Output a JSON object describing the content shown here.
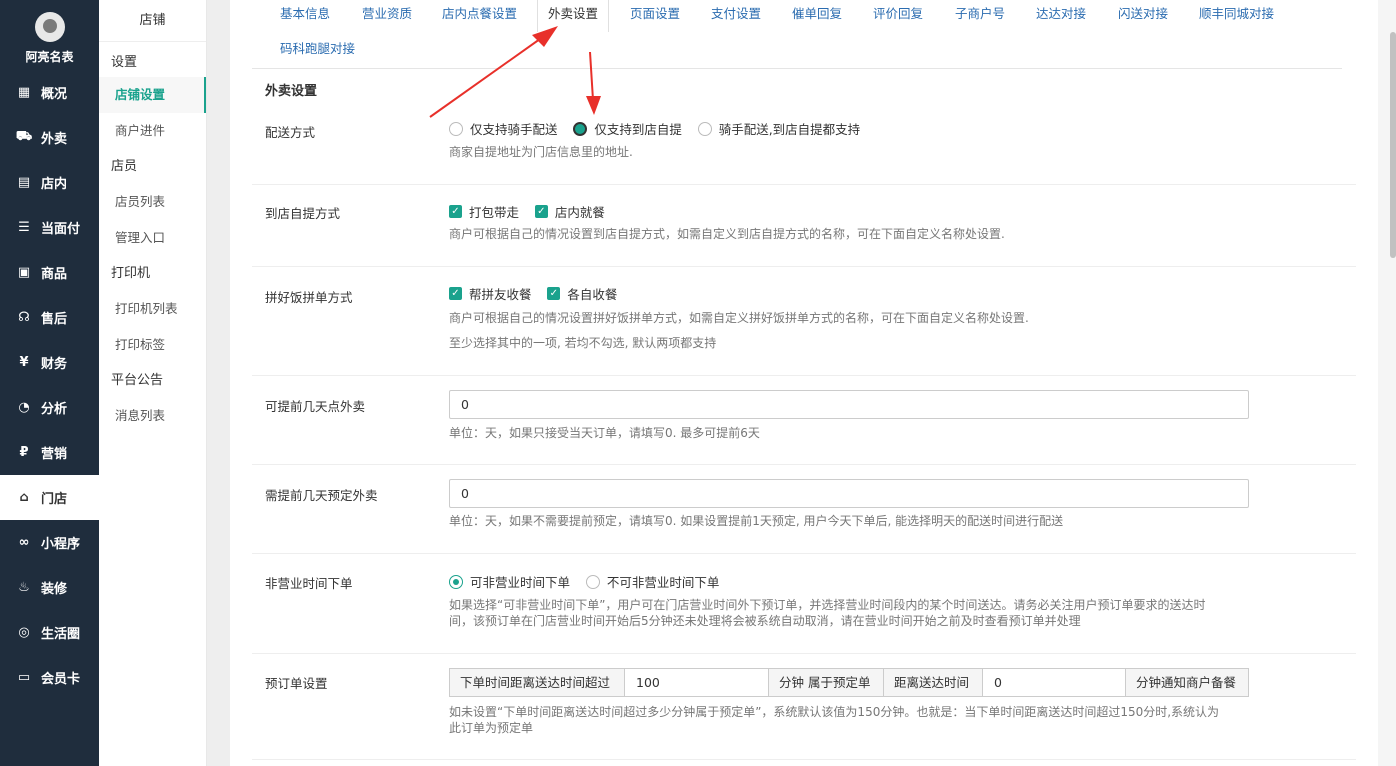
{
  "sidebar": {
    "brand": "阿亮名表",
    "items": [
      {
        "label": "概况",
        "icon": "overview-icon",
        "glyph": "▦"
      },
      {
        "label": "外卖",
        "icon": "delivery-icon",
        "glyph": "⛟"
      },
      {
        "label": "店内",
        "icon": "store-icon",
        "glyph": "▤"
      },
      {
        "label": "当面付",
        "icon": "pay-icon",
        "glyph": "☰"
      },
      {
        "label": "商品",
        "icon": "goods-icon",
        "glyph": "▣"
      },
      {
        "label": "售后",
        "icon": "aftersale-icon",
        "glyph": "☊"
      },
      {
        "label": "财务",
        "icon": "finance-icon",
        "glyph": "¥"
      },
      {
        "label": "分析",
        "icon": "analysis-icon",
        "glyph": "◔"
      },
      {
        "label": "营销",
        "icon": "marketing-icon",
        "glyph": "₽"
      },
      {
        "label": "门店",
        "icon": "shop-icon",
        "glyph": "⌂"
      },
      {
        "label": "小程序",
        "icon": "miniapp-icon",
        "glyph": "∞"
      },
      {
        "label": "装修",
        "icon": "decorate-icon",
        "glyph": "♨"
      },
      {
        "label": "生活圈",
        "icon": "life-icon",
        "glyph": "◎"
      },
      {
        "label": "会员卡",
        "icon": "card-icon",
        "glyph": "▭"
      }
    ]
  },
  "submenu": {
    "title": "店铺",
    "g1": "设置",
    "i1": "店铺设置",
    "i2": "商户进件",
    "g2": "店员",
    "i3": "店员列表",
    "i4": "管理入口",
    "g3": "打印机",
    "i5": "打印机列表",
    "i6": "打印标签",
    "g4": "平台公告",
    "i7": "消息列表"
  },
  "tabs": {
    "t1": "基本信息",
    "t2": "营业资质",
    "t3": "店内点餐设置",
    "t4": "外卖设置",
    "t5": "页面设置",
    "t6": "支付设置",
    "t7": "催单回复",
    "t8": "评价回复",
    "t9": "子商户号",
    "t10": "达达对接",
    "t11": "闪送对接",
    "t12": "顺丰同城对接",
    "t13": "码科跑腿对接"
  },
  "section_title": "外卖设置",
  "delivery": {
    "label": "配送方式",
    "opt1": "仅支持骑手配送",
    "opt2": "仅支持到店自提",
    "opt3": "骑手配送,到店自提都支持",
    "help": "商家自提地址为门店信息里的地址."
  },
  "pickup": {
    "label": "到店自提方式",
    "opt1": "打包带走",
    "opt2": "店内就餐",
    "help": "商户可根据自己的情况设置到店自提方式，如需自定义到店自提方式的名称，可在下面自定义名称处设置."
  },
  "group": {
    "label": "拼好饭拼单方式",
    "opt1": "帮拼友收餐",
    "opt2": "各自收餐",
    "help1": "商户可根据自己的情况设置拼好饭拼单方式，如需自定义拼好饭拼单方式的名称，可在下面自定义名称处设置.",
    "help2": "至少选择其中的一项, 若均不勾选, 默认两项都支持"
  },
  "advance_days": {
    "label": "可提前几天点外卖",
    "value": "0",
    "help": "单位：天，如果只接受当天订单，请填写0. 最多可提前6天"
  },
  "need_days": {
    "label": "需提前几天预定外卖",
    "value": "0",
    "help": "单位：天，如果不需要提前预定，请填写0. 如果设置提前1天预定, 用户今天下单后, 能选择明天的配送时间进行配送"
  },
  "offhours": {
    "label": "非营业时间下单",
    "opt1": "可非营业时间下单",
    "opt2": "不可非营业时间下单",
    "help1": "如果选择“可非营业时间下单”，用户可在门店营业时间外下预订单，并选择营业时间段内的某个时间送达。请务必关注用户预订单要求的送达时",
    "help2": "间，该预订单在门店营业时间开始后5分钟还未处理将会被系统自动取消，请在营业时间开始之前及时查看预订单并处理"
  },
  "preorder": {
    "label": "预订单设置",
    "addon1": "下单时间距离送达时间超过",
    "value1": "100",
    "addon2": "分钟 属于预定单",
    "addon3": "距离送达时间",
    "value2": "0",
    "addon4": "分钟通知商户备餐",
    "help1": "如未设置“下单时间距离送达时间超过多少分钟属于预定单”，系统默认该值为150分钟。也就是：当下单时间距离送达时间超过150分时,系统认为",
    "help2": "此订单为预定单"
  },
  "colors": {
    "accent": "#1aa28d",
    "sidebar_bg": "#1f2d3d",
    "link": "#2b6cb0",
    "arrow": "#e8302a"
  }
}
